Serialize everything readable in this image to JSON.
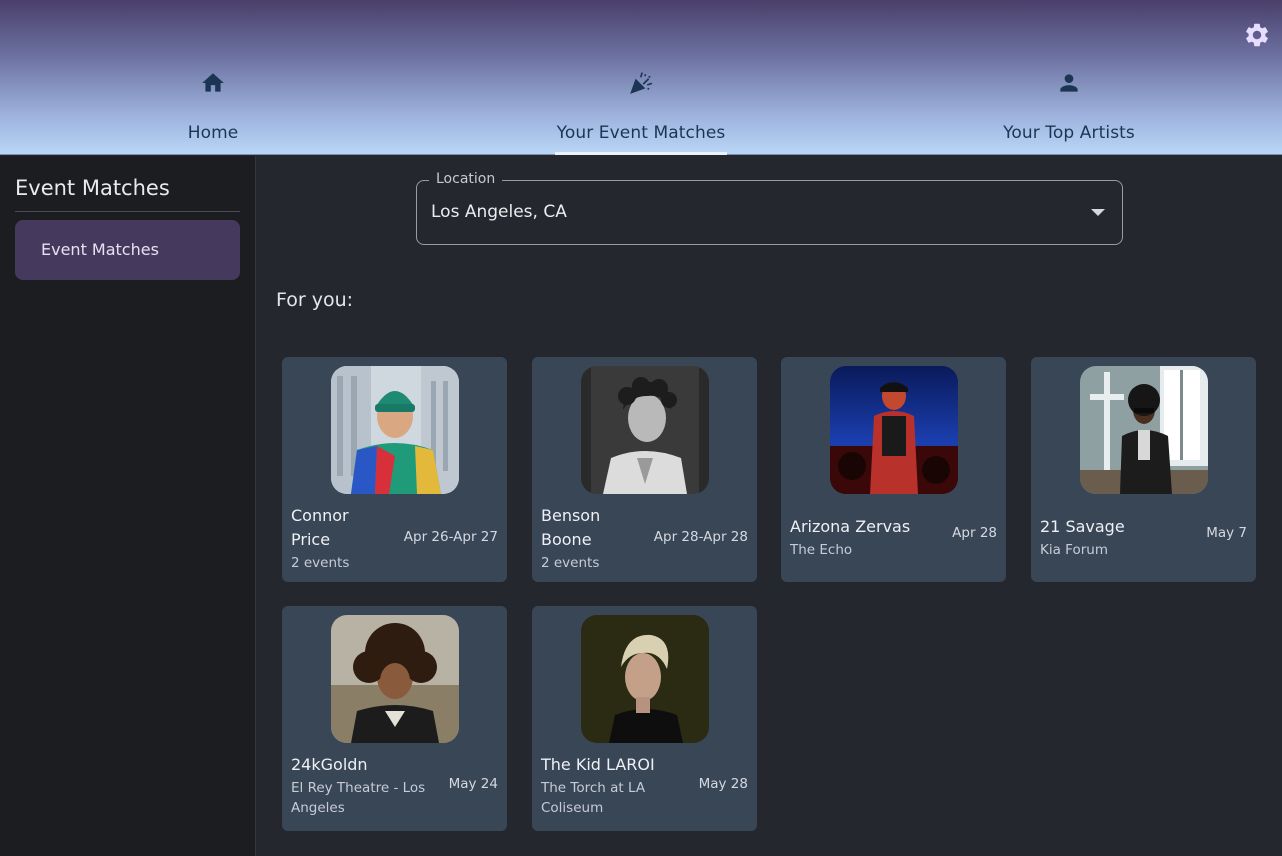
{
  "header": {
    "settings_icon": "gear-icon",
    "tabs": [
      {
        "label": "Home",
        "icon": "home-icon"
      },
      {
        "label": "Your Event Matches",
        "icon": "party-popper-icon"
      },
      {
        "label": "Your Top Artists",
        "icon": "person-icon"
      }
    ],
    "active_tab": "Your Event Matches"
  },
  "sidebar": {
    "title": "Event Matches",
    "items": [
      {
        "label": "Event Matches",
        "selected": true
      }
    ]
  },
  "location": {
    "label": "Location",
    "value": "Los Angeles, CA"
  },
  "section_title": "For you:",
  "events": [
    {
      "artist_line1": "Connor",
      "artist_line2": "Price",
      "detail": "2 events",
      "dates": "Apr 26-Apr 27"
    },
    {
      "artist_line1": "Benson",
      "artist_line2": "Boone",
      "detail": "2 events",
      "dates": "Apr 28-Apr 28"
    },
    {
      "artist_line1": "Arizona Zervas",
      "detail": "The Echo",
      "dates": "Apr 28"
    },
    {
      "artist_line1": "21 Savage",
      "detail": "Kia Forum",
      "dates": "May 7"
    },
    {
      "artist_line1": "24kGoldn",
      "detail_line1": "El Rey Theatre - Los",
      "detail_line2": "Angeles",
      "dates": "May 24"
    },
    {
      "artist_line1": "The Kid LAROI",
      "detail_line1": "The Torch at LA",
      "detail_line2": "Coliseum",
      "dates": "May 28"
    }
  ],
  "colors": {
    "header_gradient_top": "#4a3f6b",
    "header_gradient_bottom": "#b9d6f7",
    "sidebar_selected": "#453a5d",
    "card_background": "#394656",
    "page_background": "#24272d",
    "icon_accent": "#e8dcff"
  }
}
